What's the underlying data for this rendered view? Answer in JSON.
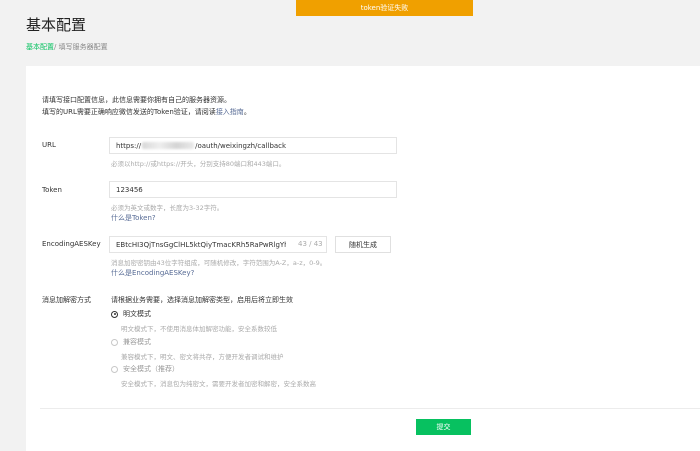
{
  "toast": {
    "message": "token验证失败"
  },
  "header": {
    "title": "基本配置",
    "breadcrumb": {
      "current": "基本配置",
      "separator": "/",
      "next": "填写服务器配置"
    }
  },
  "intro": {
    "line1": "请填写接口配置信息，此信息需要你拥有自己的服务器资源。",
    "line2_prefix": "填写的URL需要正确响应微信发送的Token验证，请阅读",
    "line2_link": "接入指南",
    "line2_suffix": "。"
  },
  "form": {
    "url": {
      "label": "URL",
      "value_prefix": "https://",
      "value_suffix": "/oauth/weixingzh/callback",
      "hint": "必须以http://或https://开头，分别支持80端口和443端口。"
    },
    "token": {
      "label": "Token",
      "value": "123456",
      "hint": "必须为英文或数字，长度为3-32字符。",
      "help_link": "什么是Token?"
    },
    "aes_key": {
      "label": "EncodingAESKey",
      "value": "EBtcHI3QjTnsGgClHL5ktQiyTmacKRh5RaPwRlgYhQE",
      "counter": "43 / 43",
      "generate_label": "随机生成",
      "hint": "消息加密密钥由43位字符组成，可随机修改，字符范围为A-Z，a-z，0-9。",
      "help_link": "什么是EncodingAESKey?"
    },
    "encrypt_mode": {
      "label": "消息加解密方式",
      "instruction": "请根据业务需要，选择消息加解密类型，启用后将立即生效",
      "options": [
        {
          "label": "明文模式",
          "desc": "明文模式下，不使用消息体加解密功能，安全系数较低",
          "checked": true
        },
        {
          "label": "兼容模式",
          "desc": "兼容模式下，明文、密文将共存，方便开发者调试和维护",
          "checked": false
        },
        {
          "label": "安全模式（推荐）",
          "desc": "安全模式下，消息包为纯密文，需要开发者加密和解密，安全系数高",
          "checked": false
        }
      ]
    },
    "submit_label": "提交"
  }
}
